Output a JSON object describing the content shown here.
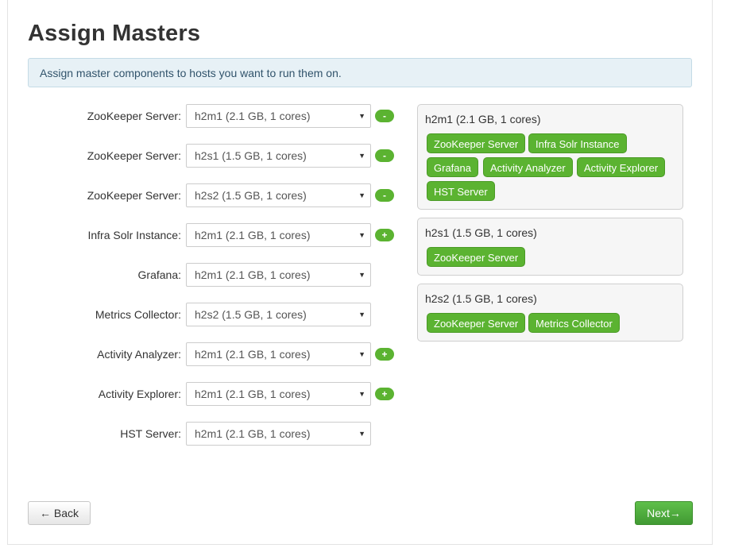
{
  "page": {
    "title": "Assign Masters",
    "alert": "Assign master components to hosts you want to run them on."
  },
  "assignments": [
    {
      "label": "ZooKeeper Server:",
      "value": "h2m1 (2.1 GB, 1 cores)",
      "action": "-"
    },
    {
      "label": "ZooKeeper Server:",
      "value": "h2s1 (1.5 GB, 1 cores)",
      "action": "-"
    },
    {
      "label": "ZooKeeper Server:",
      "value": "h2s2 (1.5 GB, 1 cores)",
      "action": "-"
    },
    {
      "label": "Infra Solr Instance:",
      "value": "h2m1 (2.1 GB, 1 cores)",
      "action": "+"
    },
    {
      "label": "Grafana:",
      "value": "h2m1 (2.1 GB, 1 cores)",
      "action": ""
    },
    {
      "label": "Metrics Collector:",
      "value": "h2s2 (1.5 GB, 1 cores)",
      "action": ""
    },
    {
      "label": "Activity Analyzer:",
      "value": "h2m1 (2.1 GB, 1 cores)",
      "action": "+"
    },
    {
      "label": "Activity Explorer:",
      "value": "h2m1 (2.1 GB, 1 cores)",
      "action": "+"
    },
    {
      "label": "HST Server:",
      "value": "h2m1 (2.1 GB, 1 cores)",
      "action": ""
    }
  ],
  "select_caret": "▼",
  "hosts": [
    {
      "name": "h2m1 (2.1 GB, 1 cores)",
      "components": [
        "ZooKeeper Server",
        "Infra Solr Instance",
        "Grafana",
        "Activity Analyzer",
        "Activity Explorer",
        "HST Server"
      ]
    },
    {
      "name": "h2s1 (1.5 GB, 1 cores)",
      "components": [
        "ZooKeeper Server"
      ]
    },
    {
      "name": "h2s2 (1.5 GB, 1 cores)",
      "components": [
        "ZooKeeper Server",
        "Metrics Collector"
      ]
    }
  ],
  "footer": {
    "back_label": "← Back",
    "next_label": "Next→"
  },
  "colors": {
    "accent_green": "#5bb331",
    "alert_bg": "#e7f1f6"
  }
}
